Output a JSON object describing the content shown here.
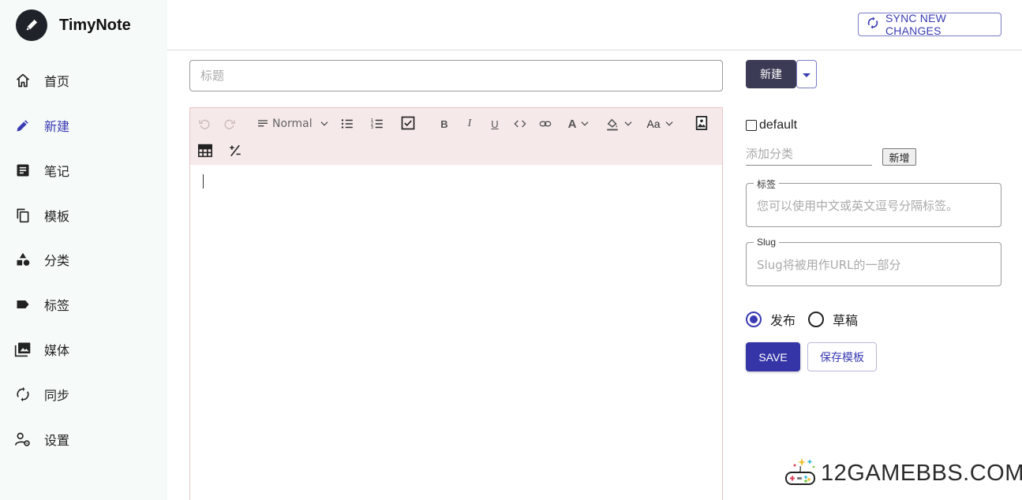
{
  "app": {
    "name": "TimyNote",
    "logo_icon": "pencil-icon"
  },
  "sidebar": {
    "items": [
      {
        "label": "首页",
        "icon": "home-icon",
        "active": false
      },
      {
        "label": "新建",
        "icon": "pencil-icon",
        "active": true
      },
      {
        "label": "笔记",
        "icon": "note-icon",
        "active": false
      },
      {
        "label": "模板",
        "icon": "copy-icon",
        "active": false
      },
      {
        "label": "分类",
        "icon": "shapes-icon",
        "active": false
      },
      {
        "label": "标签",
        "icon": "label-icon",
        "active": false
      },
      {
        "label": "媒体",
        "icon": "photo-library-icon",
        "active": false
      },
      {
        "label": "同步",
        "icon": "sync-icon",
        "active": false
      },
      {
        "label": "设置",
        "icon": "user-settings-icon",
        "active": false
      }
    ]
  },
  "header": {
    "sync_label": "SYNC NEW CHANGES"
  },
  "editor": {
    "title_placeholder": "标题",
    "toolbar": {
      "block_format": "Normal",
      "font_size_label": "Aa"
    }
  },
  "side": {
    "new_label": "新建",
    "category": {
      "label": "default",
      "checked": false
    },
    "add_category_placeholder": "添加分类",
    "add_category_button": "新增",
    "tags": {
      "legend": "标签",
      "placeholder": "您可以使用中文或英文逗号分隔标签。"
    },
    "slug": {
      "legend": "Slug",
      "placeholder": "Slug将被用作URL的一部分"
    },
    "status_options": [
      {
        "label": "发布",
        "checked": true
      },
      {
        "label": "草稿",
        "checked": false
      }
    ],
    "save_label": "SAVE",
    "save_template_label": "保存模板"
  },
  "watermark": {
    "text": "12GAMEBBS.COM"
  },
  "colors": {
    "accent": "#3a3bb3",
    "primary_button": "#3535a8",
    "dark_button": "#3b3b55",
    "sidebar_bg": "#f6faf8",
    "toolbar_bg": "#f6e9e9"
  }
}
